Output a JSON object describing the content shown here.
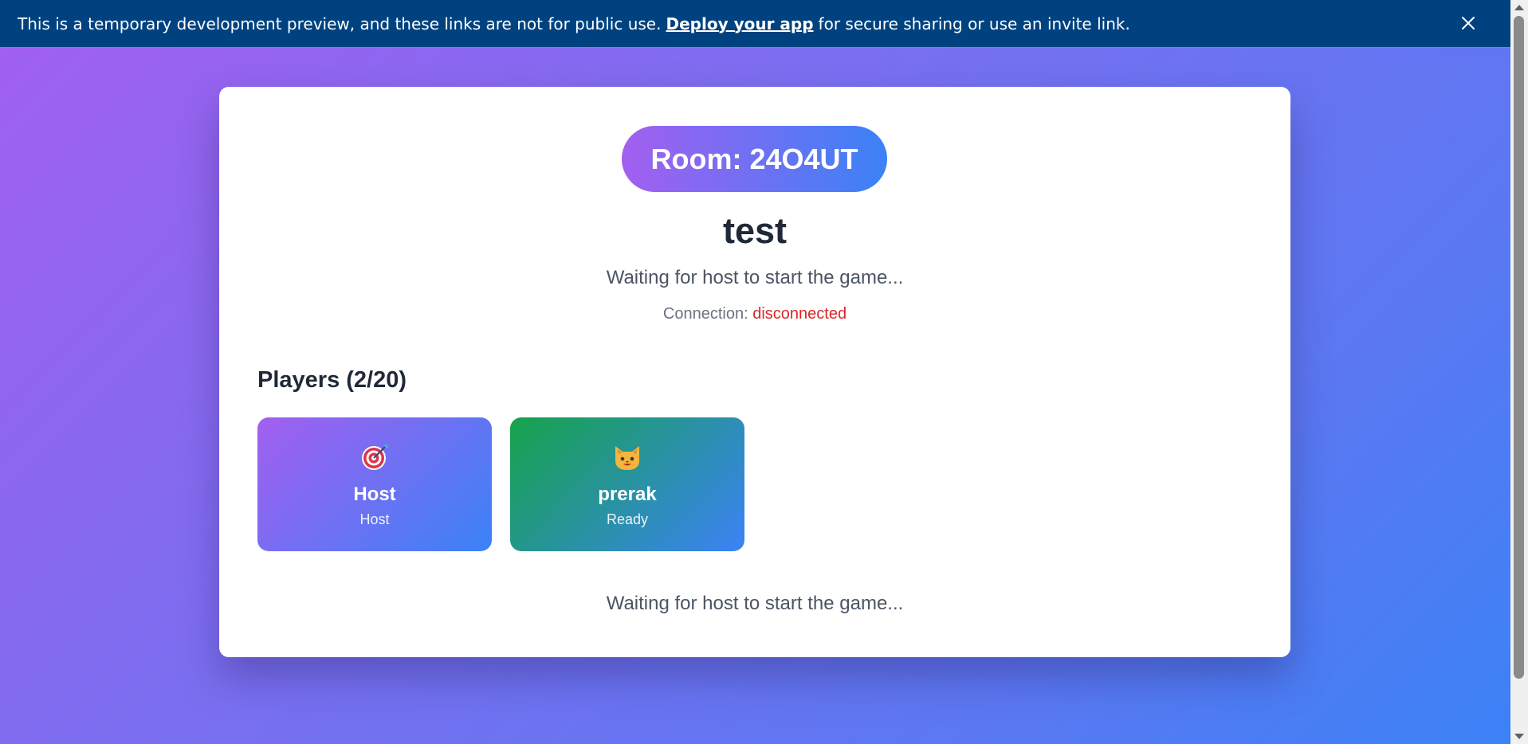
{
  "banner": {
    "text_before": "This is a temporary development preview, and these links are not for public use.",
    "link_label": "Deploy your app",
    "text_after": "for secure sharing or use an invite link.",
    "close_icon": "close-icon"
  },
  "room": {
    "code_label": "Room: 24O4UT",
    "title": "test",
    "status": "Waiting for host to start the game...",
    "connection_label": "Connection:",
    "connection_state": "disconnected"
  },
  "players": {
    "heading": "Players (2/20)",
    "items": [
      {
        "avatar": "target-emoji",
        "name": "Host",
        "role": "Host"
      },
      {
        "avatar": "cat-face-emoji",
        "name": "prerak",
        "role": "Ready"
      }
    ]
  },
  "footer": {
    "status": "Waiting for host to start the game..."
  },
  "colors": {
    "banner_bg": "#00427f",
    "accent_purple": "#a35ff0",
    "accent_blue": "#3b82f6",
    "accent_green": "#16a34a",
    "disconnected": "#dc2626"
  }
}
